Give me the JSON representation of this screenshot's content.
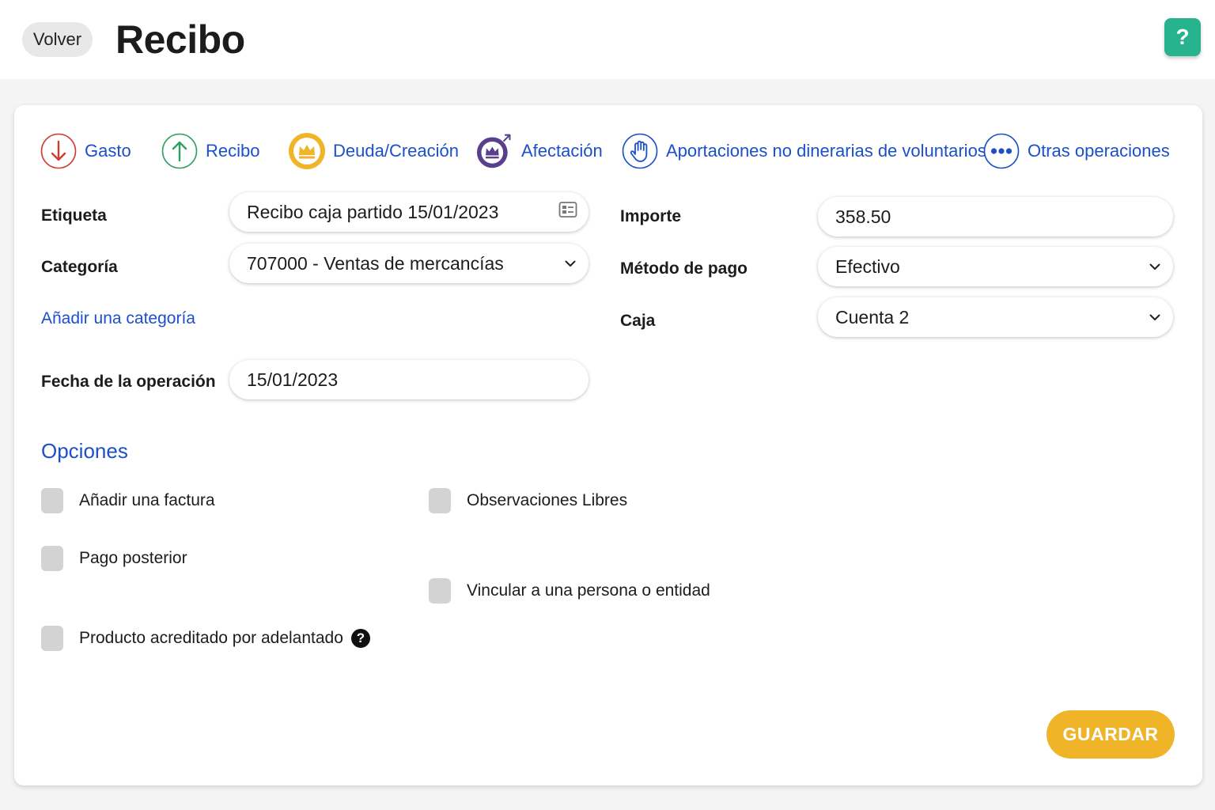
{
  "header": {
    "back_label": "Volver",
    "title": "Recibo",
    "help_label": "?"
  },
  "operation_tabs": [
    {
      "label": "Gasto",
      "icon": "arrow-down-icon",
      "color": "#d43a2c"
    },
    {
      "label": "Recibo",
      "icon": "arrow-up-icon",
      "color": "#2f9e62"
    },
    {
      "label": "Deuda/Creación",
      "icon": "crown-icon",
      "color": "#f0b429"
    },
    {
      "label": "Afectación",
      "icon": "crown-arrow-icon",
      "color": "#5a3f8f"
    },
    {
      "label": "Aportaciones no dinerarias de voluntarios",
      "icon": "hand-icon",
      "color": "#1b50c8"
    },
    {
      "label": "Otras operaciones",
      "icon": "more-dots-icon",
      "color": "#1b50c8"
    }
  ],
  "form": {
    "etiqueta": {
      "label": "Etiqueta",
      "value": "Recibo caja partido 15/01/2023"
    },
    "categoria": {
      "label": "Categoría",
      "value": "707000 - Ventas de mercancías"
    },
    "add_category_link": "Añadir una categoría",
    "fecha": {
      "label": "Fecha de la operación",
      "value": "15/01/2023"
    },
    "importe": {
      "label": "Importe",
      "value": "358.50"
    },
    "metodo_pago": {
      "label": "Método de pago",
      "value": "Efectivo"
    },
    "caja": {
      "label": "Caja",
      "value": "Cuenta 2"
    }
  },
  "options": {
    "title": "Opciones",
    "items": [
      {
        "label": "Añadir una factura",
        "checked": false
      },
      {
        "label": "Observaciones Libres",
        "checked": false
      },
      {
        "label": "Pago posterior",
        "checked": false
      },
      {
        "label": "Vincular a una persona o entidad",
        "checked": false
      },
      {
        "label": "Producto acreditado por adelantado",
        "checked": false
      }
    ]
  },
  "actions": {
    "save_label": "GUARDAR"
  },
  "colors": {
    "accent_blue": "#1b50c8",
    "help_green": "#28b38f",
    "save_yellow": "#f0b429"
  }
}
